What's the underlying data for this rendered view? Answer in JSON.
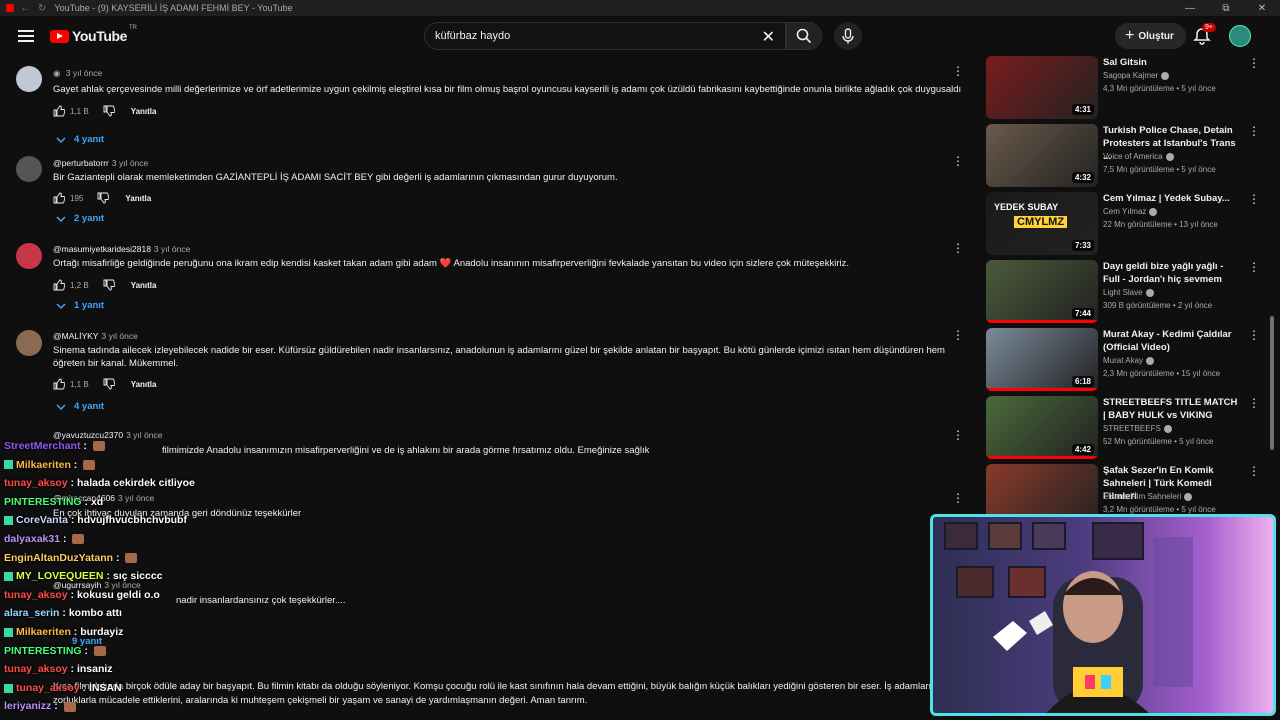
{
  "window": {
    "title": "YouTube - (9) KAYSERİLİ İŞ ADAMI FEHMİ BEY - YouTube"
  },
  "header": {
    "logo_text": "YouTube",
    "logo_superscript": "TR",
    "search_value": "küfürbaz haydo",
    "create_label": "Oluştur",
    "notification_count": "9+"
  },
  "comments": [
    {
      "author": "",
      "time": "3 yıl önce",
      "text": "Gayet ahlak çerçevesinde milli değerlerimize ve örf adetlerimize uygun çekilmiş eleştirel kısa bir film olmuş başrol oyuncusu kayserili iş adamı çok üzüldü fabrikasını kaybettiğinde onunla birlikte ağladık çok duygusaldı",
      "likes": "1,1 B",
      "reply_label": "Yanıtla",
      "replies": "4 yanıt"
    },
    {
      "author": "@perturbatorrr",
      "time": "3 yıl önce",
      "text": "Bir Gaziantepli olarak memleketimden GAZİANTEPLİ İŞ ADAMI SACİT BEY gibi değerli iş adamlarının çıkmasından gurur duyuyorum.",
      "likes": "195",
      "reply_label": "Yanıtla",
      "replies": "2 yanıt"
    },
    {
      "author": "@masumiyetkaridesi2818",
      "time": "3 yıl önce",
      "text": "Ortağı misafirliğe geldiğinde peruğunu ona ikram edip kendisi kasket takan adam gibi adam ❤️ Anadolu insanının misafirperverliğini fevkalade yansıtan bu video için sizlere çok müteşekkiriz.",
      "likes": "1,2 B",
      "reply_label": "Yanıtla",
      "replies": "1 yanıt"
    },
    {
      "author": "@MALİYKY",
      "time": "3 yıl önce",
      "text": "Sinema tadında ailecek izleyebilecek nadide bir eser. Küfürsüz güldürebilen nadir insanlarsınız, anadolunun iş adamlarını güzel bir şekilde anlatan bir başyapıt. Bu kötü günlerde içimizi ısıtan hem düşündüren hem öğreten bir kanal. Mükemmel.",
      "likes": "1,1 B",
      "reply_label": "Yanıtla",
      "replies": "4 yanıt"
    },
    {
      "author": "@yavuztuzcu2370",
      "time": "3 yıl önce",
      "text": "filmimizde Anadolu insanımızın misafirperverliğini ve de iş ahlakını bir arada görme fırsatımız oldu. Emeğinize sağlık",
      "likes": "",
      "reply_label": "Yanıtla",
      "replies": ""
    },
    {
      "author": "@miraccan4606",
      "time": "3 yıl önce",
      "text": "En çok ihtiyaç duyulan zamanda geri döndünüz teşekkürler",
      "likes": "287",
      "reply_label": "Yanıtla",
      "replies": "4 yanıt"
    },
    {
      "author": "@ugurrsayih",
      "time": "3 yıl önce",
      "text": "nadir insanlardansınız çok teşekkürler....",
      "likes": "",
      "reply_label": "Yanıtla",
      "replies": "9 yanıt"
    },
    {
      "author": "",
      "time": "",
      "text": "Kısa film dalında birçok ödüle aday bir başyapıt. Bu filmin kitabı da olduğu söyleniyor. Komşu çocuğu rolü ile kast sınıfının hala devam ettiğini, büyük balığın küçük balıkları yediğini gösteren bir eser. İş adamlarının m",
      "text2": "zorluklarla mücadele ettiklerini, aralarında ki muhteşem çekişmeli bir yaşam ve sanayi de yardımlaşmanın değeri. Aman tanrım.",
      "likes": "",
      "reply_label": "Yanıtla",
      "replies": ""
    }
  ],
  "sidebar": {
    "videos": [
      {
        "title": "Sal Gitsin",
        "channel": "Sagopa Kajmer",
        "meta": "4,3 Mn görüntüleme • 5 yıl önce",
        "duration": "4:31",
        "progress": 0,
        "thumb_color": "#7a1c1c"
      },
      {
        "title": "Turkish Police Chase, Detain Protesters at Istanbul's Trans ...",
        "channel": "Voice of America",
        "meta": "7,5 Mn görüntüleme • 5 yıl önce",
        "duration": "4:32",
        "progress": 0,
        "thumb_color": "#6a5a4a"
      },
      {
        "title": "Cem Yılmaz | Yedek Subay...",
        "channel": "Cem Yılmaz",
        "meta": "22 Mn görüntüleme • 13 yıl önce",
        "duration": "7:33",
        "progress": 0,
        "thumb_color": "#1a1a1a",
        "thumb_text1": "YEDEK SUBAY",
        "thumb_text2": "CMYLMZ"
      },
      {
        "title": "Dayı geldi bize yağlı yağlı - Full - Jordan'ı hiç sevmem",
        "channel": "Light Slave",
        "meta": "309 B görüntüleme • 2 yıl önce",
        "duration": "7:44",
        "progress": 100,
        "thumb_color": "#4a5a3a"
      },
      {
        "title": "Murat Akay - Kedimi Çaldılar (Official Video)",
        "channel": "Murat Akay",
        "meta": "2,3 Mn görüntüleme • 15 yıl önce",
        "duration": "6:18",
        "progress": 100,
        "thumb_color": "#7a8a9a"
      },
      {
        "title": "STREETBEEFS TITLE MATCH | BABY HULK vs VIKING",
        "channel": "STREETBEEFS",
        "meta": "52 Mn görüntüleme • 5 yıl önce",
        "duration": "4:42",
        "progress": 100,
        "thumb_color": "#4a6a3a"
      },
      {
        "title": "Şafak Sezer'in En Komik Sahneleri | Türk Komedi Filmleri",
        "channel": "Efsane Film Sahneleri",
        "meta": "3,2 Mn görüntüleme • 5 yıl önce",
        "duration": "",
        "progress": 0,
        "thumb_color": "#8a3a2a"
      }
    ]
  },
  "chat": [
    {
      "user": "StreetMerchant",
      "color": "#8b5cf6",
      "msg": "",
      "emote": true
    },
    {
      "user": "Milkaeriten",
      "color": "#ffb84d",
      "msg": "",
      "emote": true
    },
    {
      "user": "tunay_aksoy",
      "color": "#ff4d4d",
      "msg": "halada cekirdek citliyoe",
      "emote": false
    },
    {
      "user": "PINTERESTING",
      "color": "#44ff77",
      "msg": "xd",
      "emote": false
    },
    {
      "user": "CoreVanta",
      "color": "#cbd5ff",
      "msg": "hdvujfhvucbhchvbubf",
      "emote": false
    },
    {
      "user": "dalyaxak31",
      "color": "#b794f6",
      "msg": "",
      "emote": true
    },
    {
      "user": "EnginAltanDuzYatann",
      "color": "#ffcc66",
      "msg": "",
      "emote": true
    },
    {
      "user": "MY_LOVEQUEEN",
      "color": "#d9ff44",
      "msg": "sıç sicccc",
      "emote": false
    },
    {
      "user": "tunay_aksoy",
      "color": "#ff4d4d",
      "msg": "kokusu geldi o.o",
      "emote": false
    },
    {
      "user": "alara_serin",
      "color": "#9ad7ff",
      "msg": "kombo attı",
      "emote": false
    },
    {
      "user": "Milkaeriten",
      "color": "#ffb84d",
      "msg": "burdayiz",
      "emote": false
    },
    {
      "user": "PINTERESTING",
      "color": "#44ff77",
      "msg": "",
      "emote": true
    },
    {
      "user": "tunay_aksoy",
      "color": "#ff4d4d",
      "msg": "insaniz",
      "emote": false
    },
    {
      "user": "tunay_aksoy",
      "color": "#ff4d4d",
      "msg": "İNSAN",
      "emote": false
    },
    {
      "user": "leriyanizz",
      "color": "#b794f6",
      "msg": "",
      "emote": true
    }
  ]
}
